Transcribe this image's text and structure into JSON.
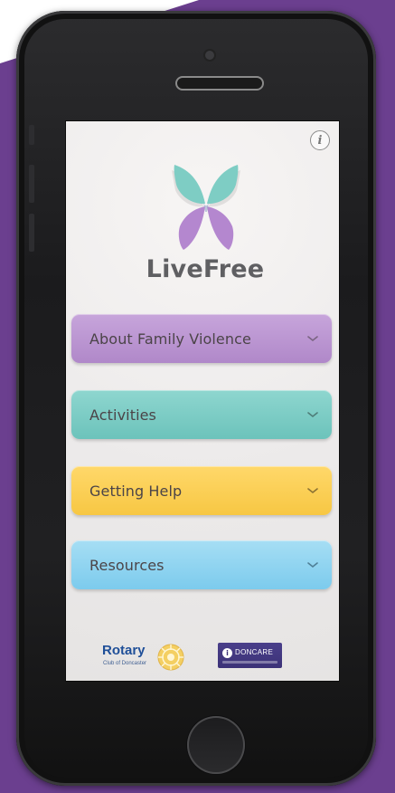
{
  "app": {
    "brand_name": "LiveFree",
    "info_label": "i"
  },
  "menu": {
    "items": [
      {
        "label": "About Family Violence",
        "color": "#b88fd0",
        "icon": "chevron-down-icon"
      },
      {
        "label": "Activities",
        "color": "#7ccbc2",
        "icon": "chevron-down-icon"
      },
      {
        "label": "Getting Help",
        "color": "#fbcf50",
        "icon": "chevron-down-icon"
      },
      {
        "label": "Resources",
        "color": "#8fd4f1",
        "icon": "chevron-down-icon"
      }
    ]
  },
  "sponsors": {
    "rotary": {
      "name": "Rotary",
      "subtitle": "Club of Doncaster"
    },
    "doncare": {
      "name": "DONCARE"
    }
  },
  "colors": {
    "background": "#6b3f8f",
    "brand_text": "#5f5f62"
  }
}
